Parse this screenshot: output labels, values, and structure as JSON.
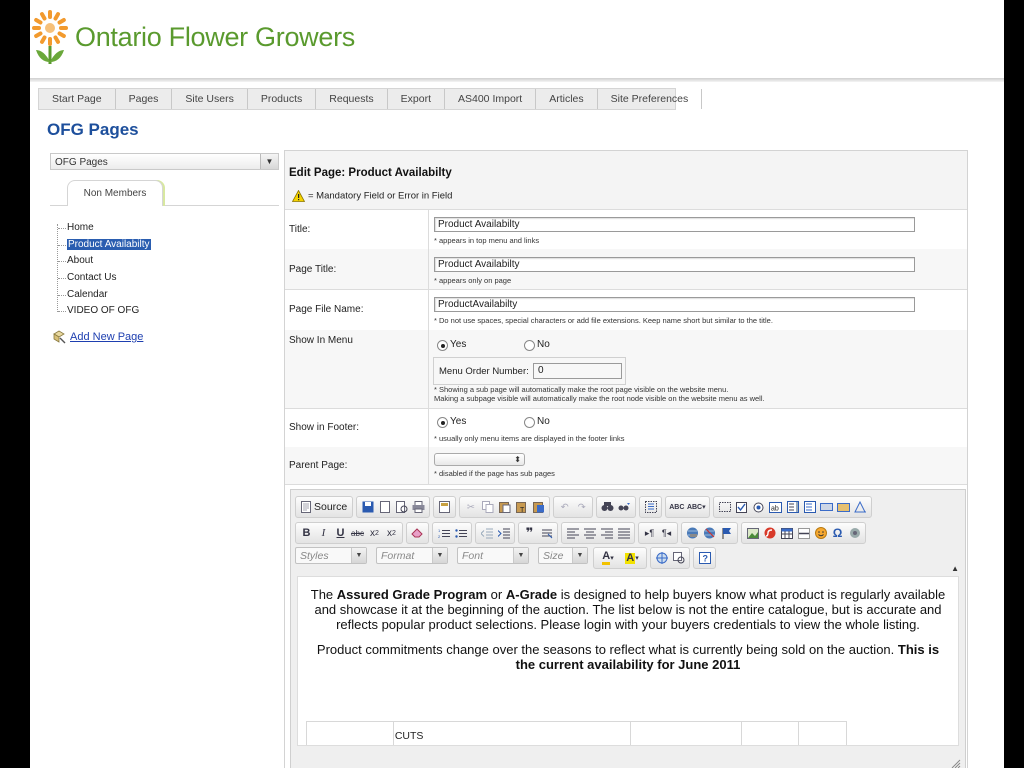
{
  "site": {
    "name": "Ontario Flower Growers",
    "brand_color": "#5a9a2e",
    "logo_color": "#f29a2e"
  },
  "nav": {
    "items": [
      "Start Page",
      "Pages",
      "Site Users",
      "Products",
      "Requests",
      "Export",
      "AS400 Import",
      "Articles",
      "Site Preferences"
    ]
  },
  "page_title": "OFG Pages",
  "left": {
    "select_value": "OFG Pages",
    "tab": "Non Members",
    "tree": [
      "Home",
      "Product Availabilty",
      "About",
      "Contact Us",
      "Calendar",
      "VIDEO OF OFG"
    ],
    "tree_selected": "Product Availabilty",
    "add_page": "Add New Page"
  },
  "form": {
    "title": "Edit Page: Product Availabilty",
    "mandatory_note": "= Mandatory Field or Error in Field",
    "title_field": {
      "label": "Title:",
      "value": "Product Availabilty",
      "note": "* appears in top menu and links"
    },
    "page_title_field": {
      "label": "Page Title:",
      "value": "Product Availabilty",
      "note": "* appears only on page"
    },
    "file_name_field": {
      "label": "Page File Name:",
      "value": "ProductAvailabilty",
      "note": "* Do not use spaces, special characters or add file extensions. Keep name short but similar to the title."
    },
    "show_in_menu": {
      "label": "Show In Menu",
      "yes": "Yes",
      "no": "No",
      "selected": "Yes",
      "order_label": "Menu Order Number:",
      "order_value": "0",
      "note1": "* Showing a sub page will automatically make the root page visible on the website menu.",
      "note2": "Making a subpage visible will automatically make the root node visible on the website menu as well."
    },
    "show_in_footer": {
      "label": "Show in Footer:",
      "yes": "Yes",
      "no": "No",
      "selected": "Yes",
      "note": "* usually only menu items are displayed in the footer links"
    },
    "parent_page": {
      "label": "Parent Page:",
      "value": "",
      "note": "* disabled if the page has sub pages"
    }
  },
  "editor": {
    "source_label": "Source",
    "combos": {
      "styles": "Styles",
      "format": "Format",
      "font": "Font",
      "size": "Size"
    },
    "p1_a": "The ",
    "p1_b": "Assured Grade Program",
    "p1_c": " or ",
    "p1_d": "A-Grade",
    "p1_e": " is designed to help buyers know what product is regularly available and showcase it at the beginning of the auction. The list below is not the entire catalogue, but is accurate and reflects popular product selections. Please login with your buyers credentials to view the whole listing.",
    "p2_a": "Product commitments change over the seasons to reflect what is currently being sold on the auction. ",
    "p2_b": "This is the current availability for June 2011",
    "table_cell": "CUTS"
  }
}
